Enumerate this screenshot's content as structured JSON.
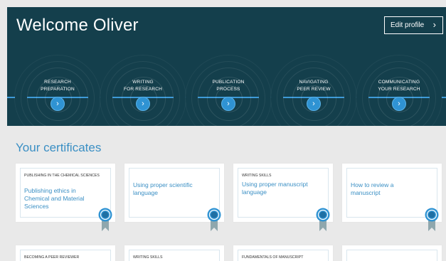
{
  "header": {
    "welcome": "Welcome Oliver",
    "edit_profile_label": "Edit profile",
    "edit_profile_chevron": "›"
  },
  "stages": [
    {
      "line1": "RESEARCH",
      "line2": "PREPARATION"
    },
    {
      "line1": "WRITING",
      "line2": "FOR RESEARCH"
    },
    {
      "line1": "PUBLICATION",
      "line2": "PROCESS"
    },
    {
      "line1": "NAVIGATING",
      "line2": "PEER REVIEW"
    },
    {
      "line1": "COMMUNICATING",
      "line2": "YOUR RESEARCH"
    }
  ],
  "stage_arrow": "›",
  "certificates": {
    "heading": "Your certificates",
    "items": [
      {
        "category": "PUBLISHING IN THE CHEMICAL SCIENCES",
        "title": "Publishing ethics in Chemical and Material Sciences"
      },
      {
        "category": "",
        "title": "Using proper scientific language"
      },
      {
        "category": "WRITING SKILLS",
        "title": "Using proper manuscript language"
      },
      {
        "category": "",
        "title": "How to review a manuscript"
      },
      {
        "category": "BECOMING A PEER REVIEWER",
        "title": ""
      },
      {
        "category": "WRITING SKILLS",
        "title": ""
      },
      {
        "category": "FUNDAMENTALS OF MANUSCRIPT",
        "title": ""
      },
      {
        "category": "",
        "title": ""
      }
    ]
  },
  "colors": {
    "hero_bg": "#143f4c",
    "accent_blue": "#3a8fc4",
    "stage_line": "#3d9ad8",
    "badge_blue": "#2f93d3",
    "badge_ribbon": "#8fa7ad"
  }
}
